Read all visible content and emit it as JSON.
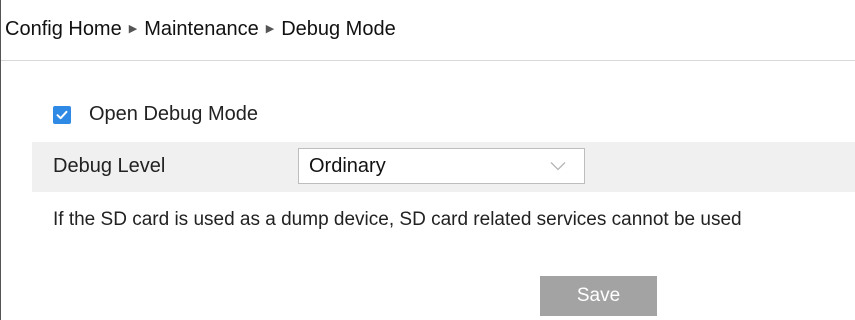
{
  "breadcrumb": {
    "items": [
      "Config Home",
      "Maintenance",
      "Debug Mode"
    ],
    "separator_icon": "triangle-right-icon"
  },
  "debug_mode": {
    "label": "Open Debug Mode",
    "checked": true,
    "checkbox_color": "#2f8ae5"
  },
  "debug_level": {
    "label": "Debug Level",
    "selected": "Ordinary",
    "chevron_icon": "chevron-down-icon"
  },
  "note": "If the SD card is used as a dump device, SD card related services cannot be used",
  "actions": {
    "save_label": "Save",
    "save_color": "#a3a3a3"
  }
}
